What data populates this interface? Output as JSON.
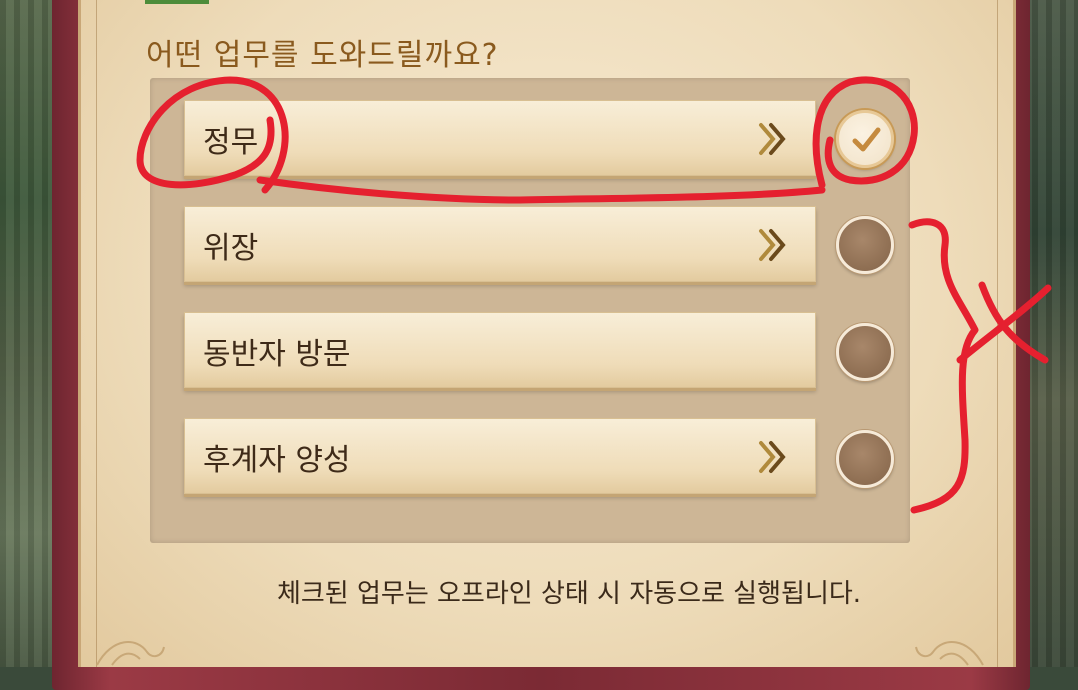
{
  "question": "어떤 업무를 도와드릴까요?",
  "options": [
    {
      "label": "정무",
      "has_arrow": true,
      "checked": true
    },
    {
      "label": "위장",
      "has_arrow": true,
      "checked": false
    },
    {
      "label": "동반자 방문",
      "has_arrow": false,
      "checked": false
    },
    {
      "label": "후계자 양성",
      "has_arrow": true,
      "checked": false
    }
  ],
  "footer_note": "체크된 업무는 오프라인 상태 시 자동으로 실행됩니다.",
  "colors": {
    "accent_title": "#8a5a1e",
    "annotation_red": "#e5202f",
    "frame": "#7b2a34"
  },
  "icons": {
    "arrow": "double-chevron-right-icon",
    "check": "checkmark-icon"
  }
}
